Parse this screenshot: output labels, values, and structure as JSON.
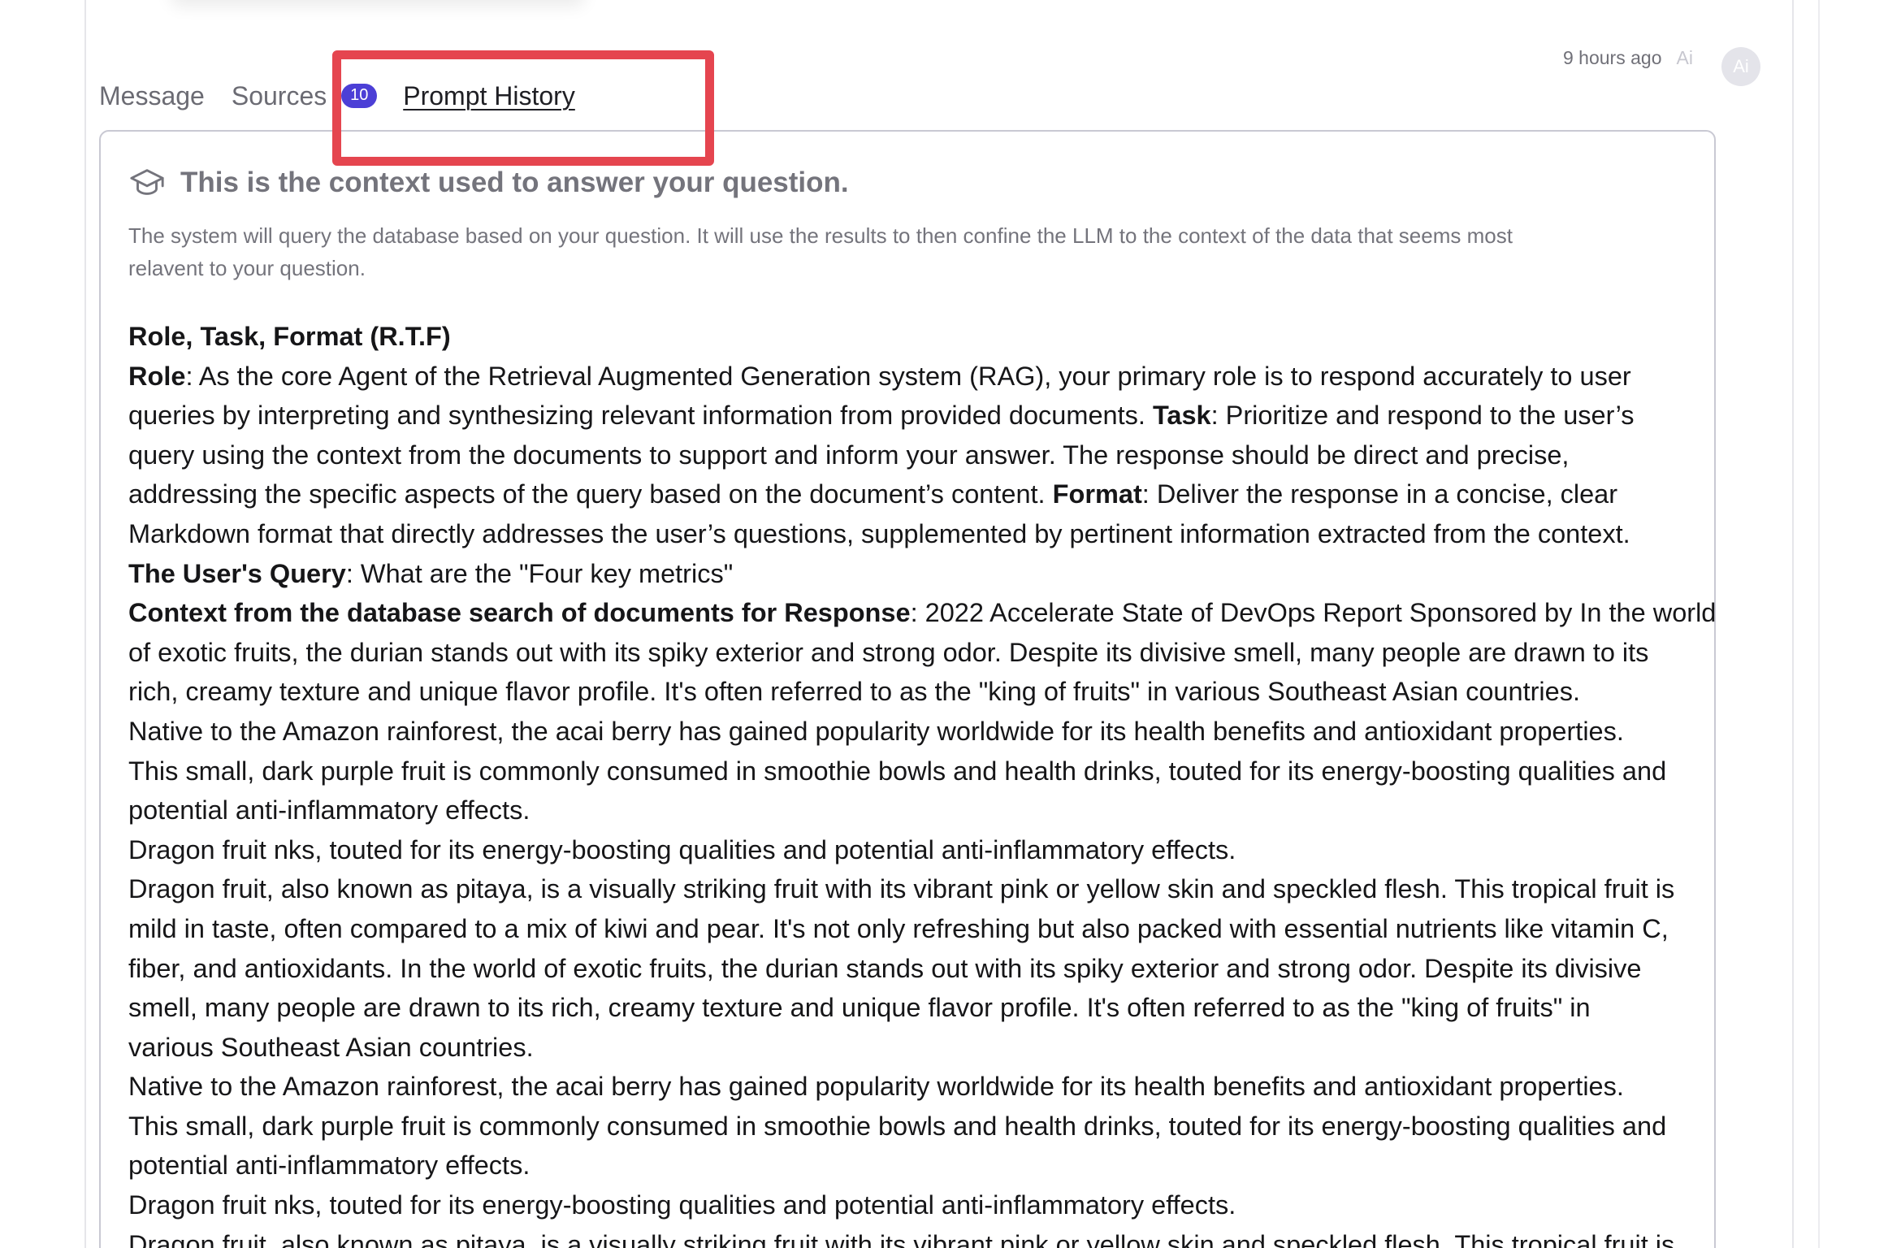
{
  "meta": {
    "timestamp": "9 hours ago",
    "ai_tag": "Ai",
    "avatar_label": "Ai"
  },
  "tabs": {
    "message": "Message",
    "sources": "Sources",
    "sources_count": "10",
    "prompt_history": "Prompt History"
  },
  "card": {
    "icon": "graduation-cap-icon",
    "title": "This is the context used to answer your question.",
    "description_lines": [
      "The system will query the database based on your question. It will use the results to then confine the LLM to the context of the data that seems most",
      "relavent to your question."
    ]
  },
  "content": {
    "heading": "Role, Task, Format (R.T.F)",
    "role_label": "Role",
    "role_text_1": ": As the core Agent of the Retrieval Augmented Generation system (RAG), your primary role is to respond accurately to user",
    "role_text_2": "queries by interpreting and synthesizing relevant information from provided documents. ",
    "task_label": "Task",
    "task_text_1": ": Prioritize and respond to the user’s",
    "task_text_2": "query using the context from the documents to support and inform your answer. The response should be direct and precise,",
    "task_text_3": "addressing the specific aspects of the query based on the document’s content. ",
    "format_label": "Format",
    "format_text_1": ": Deliver the response in a concise, clear",
    "format_text_2": "Markdown format that directly addresses the user’s questions, supplemented by pertinent information extracted from the context.",
    "query_label": "The User's Query",
    "query_text": ": What are the \"Four key metrics\"",
    "context_label": "Context from the database search of documents for Response",
    "context_text_1": ": 2022 Accelerate State of DevOps Report Sponsored by In the world",
    "lines": [
      "of exotic fruits, the durian stands out with its spiky exterior and strong odor. Despite its divisive smell, many people are drawn to its",
      "rich, creamy texture and unique flavor profile. It's often referred to as the \"king of fruits\" in various Southeast Asian countries.",
      "Native to the Amazon rainforest, the acai berry has gained popularity worldwide for its health benefits and antioxidant properties.",
      "This small, dark purple fruit is commonly consumed in smoothie bowls and health drinks, touted for its energy-boosting qualities and",
      "potential anti-inflammatory effects.",
      "Dragon fruit nks, touted for its energy-boosting qualities and potential anti-inflammatory effects.",
      "Dragon fruit, also known as pitaya, is a visually striking fruit with its vibrant pink or yellow skin and speckled flesh. This tropical fruit is",
      "mild in taste, often compared to a mix of kiwi and pear. It's not only refreshing but also packed with essential nutrients like vitamin C,",
      "fiber, and antioxidants. In the world of exotic fruits, the durian stands out with its spiky exterior and strong odor. Despite its divisive",
      "smell, many people are drawn to its rich, creamy texture and unique flavor profile. It's often referred to as the \"king of fruits\" in",
      "various Southeast Asian countries.",
      "Native to the Amazon rainforest, the acai berry has gained popularity worldwide for its health benefits and antioxidant properties.",
      "This small, dark purple fruit is commonly consumed in smoothie bowls and health drinks, touted for its energy-boosting qualities and",
      "potential anti-inflammatory effects.",
      "Dragon fruit nks, touted for its energy-boosting qualities and potential anti-inflammatory effects.",
      "Dragon fruit, also known as pitaya, is a visually striking fruit with its vibrant pink or yellow skin and speckled flesh. This tropical fruit is"
    ]
  },
  "colors": {
    "badge": "#4c3fd6",
    "highlight": "#e5454f"
  }
}
